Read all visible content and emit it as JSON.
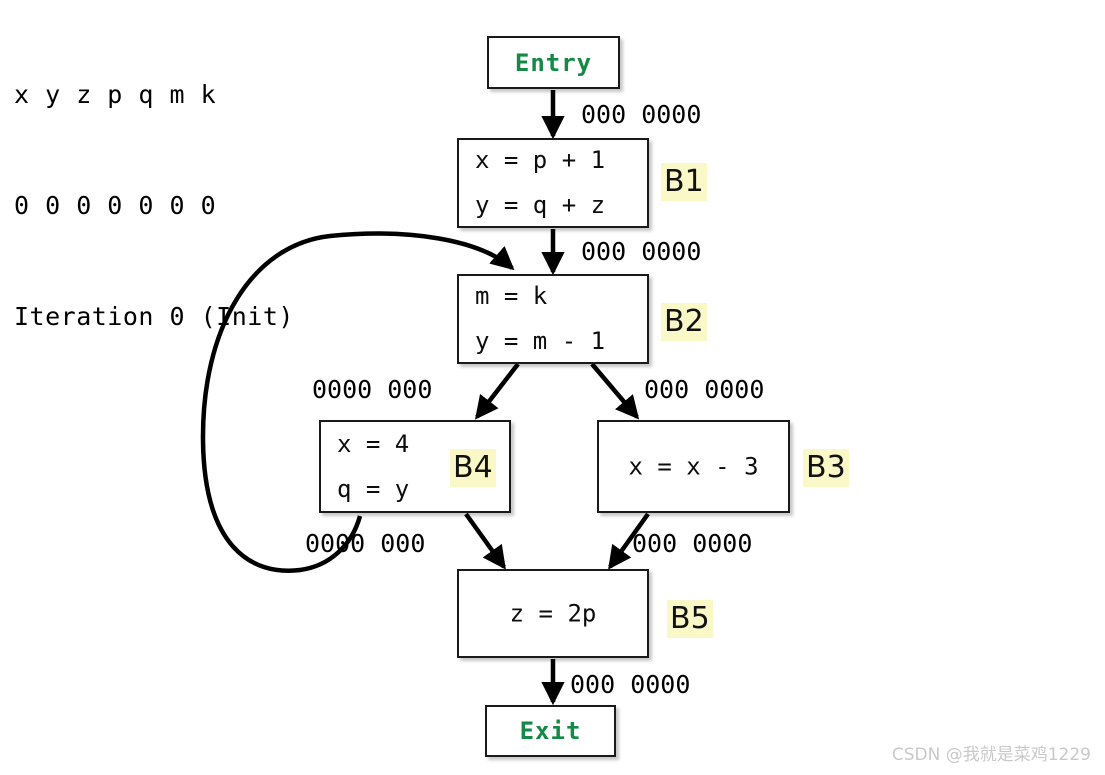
{
  "header": {
    "variables_line": "x y z p q m k",
    "values_line": "0 0 0 0 0 0 0",
    "iteration_line": "Iteration 0 (Init)"
  },
  "colors": {
    "terminal_text": "#138a46",
    "tag_highlight": "#fbf8c8",
    "edge": "#000000",
    "node_border": "#1a1a1a",
    "watermark": "#c9c9c9"
  },
  "nodes": {
    "entry": {
      "label": "Entry",
      "tag": ""
    },
    "b1": {
      "tag": "B1",
      "statements": "x = p + 1\ny = q + z"
    },
    "b2": {
      "tag": "B2",
      "statements": "m = k\ny = m - 1"
    },
    "b3": {
      "tag": "B3",
      "statements": "x = x - 3"
    },
    "b4": {
      "tag": "B4",
      "statements": "x = 4\nq = y"
    },
    "b5": {
      "tag": "B5",
      "statements": "z = 2p"
    },
    "exit": {
      "label": "Exit",
      "tag": ""
    }
  },
  "edge_labels": {
    "entry_to_b1": "000 0000",
    "b1_to_b2": "000 0000",
    "b2_to_b4": "0000 000",
    "b2_to_b3": "000 0000",
    "b4_to_b5": "0000 000",
    "b3_to_b5": "000 0000",
    "b5_to_exit": "000 0000"
  },
  "watermark": {
    "text": "CSDN @我就是菜鸡1229"
  }
}
